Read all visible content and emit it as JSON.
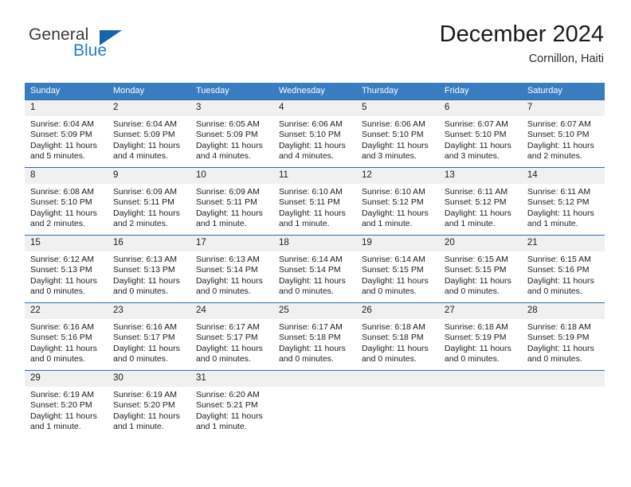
{
  "brand": {
    "name_part1": "General",
    "name_part2": "Blue",
    "triangle_icon": "triangle-icon",
    "accent_color": "#1f7fd0"
  },
  "header": {
    "title": "December 2024",
    "subtitle": "Cornillon, Haiti"
  },
  "theme": {
    "header_row_bg": "#3a7cc0",
    "cell_border": "#2f6fb0",
    "daynum_bg": "#f0f0f0",
    "text": "#1c1c1c"
  },
  "weekday_headers": [
    "Sunday",
    "Monday",
    "Tuesday",
    "Wednesday",
    "Thursday",
    "Friday",
    "Saturday"
  ],
  "weeks": [
    [
      {
        "day": "1",
        "sunrise": "Sunrise: 6:04 AM",
        "sunset": "Sunset: 5:09 PM",
        "daylight_line1": "Daylight: 11 hours",
        "daylight_line2": "and 5 minutes."
      },
      {
        "day": "2",
        "sunrise": "Sunrise: 6:04 AM",
        "sunset": "Sunset: 5:09 PM",
        "daylight_line1": "Daylight: 11 hours",
        "daylight_line2": "and 4 minutes."
      },
      {
        "day": "3",
        "sunrise": "Sunrise: 6:05 AM",
        "sunset": "Sunset: 5:09 PM",
        "daylight_line1": "Daylight: 11 hours",
        "daylight_line2": "and 4 minutes."
      },
      {
        "day": "4",
        "sunrise": "Sunrise: 6:06 AM",
        "sunset": "Sunset: 5:10 PM",
        "daylight_line1": "Daylight: 11 hours",
        "daylight_line2": "and 4 minutes."
      },
      {
        "day": "5",
        "sunrise": "Sunrise: 6:06 AM",
        "sunset": "Sunset: 5:10 PM",
        "daylight_line1": "Daylight: 11 hours",
        "daylight_line2": "and 3 minutes."
      },
      {
        "day": "6",
        "sunrise": "Sunrise: 6:07 AM",
        "sunset": "Sunset: 5:10 PM",
        "daylight_line1": "Daylight: 11 hours",
        "daylight_line2": "and 3 minutes."
      },
      {
        "day": "7",
        "sunrise": "Sunrise: 6:07 AM",
        "sunset": "Sunset: 5:10 PM",
        "daylight_line1": "Daylight: 11 hours",
        "daylight_line2": "and 2 minutes."
      }
    ],
    [
      {
        "day": "8",
        "sunrise": "Sunrise: 6:08 AM",
        "sunset": "Sunset: 5:10 PM",
        "daylight_line1": "Daylight: 11 hours",
        "daylight_line2": "and 2 minutes."
      },
      {
        "day": "9",
        "sunrise": "Sunrise: 6:09 AM",
        "sunset": "Sunset: 5:11 PM",
        "daylight_line1": "Daylight: 11 hours",
        "daylight_line2": "and 2 minutes."
      },
      {
        "day": "10",
        "sunrise": "Sunrise: 6:09 AM",
        "sunset": "Sunset: 5:11 PM",
        "daylight_line1": "Daylight: 11 hours",
        "daylight_line2": "and 1 minute."
      },
      {
        "day": "11",
        "sunrise": "Sunrise: 6:10 AM",
        "sunset": "Sunset: 5:11 PM",
        "daylight_line1": "Daylight: 11 hours",
        "daylight_line2": "and 1 minute."
      },
      {
        "day": "12",
        "sunrise": "Sunrise: 6:10 AM",
        "sunset": "Sunset: 5:12 PM",
        "daylight_line1": "Daylight: 11 hours",
        "daylight_line2": "and 1 minute."
      },
      {
        "day": "13",
        "sunrise": "Sunrise: 6:11 AM",
        "sunset": "Sunset: 5:12 PM",
        "daylight_line1": "Daylight: 11 hours",
        "daylight_line2": "and 1 minute."
      },
      {
        "day": "14",
        "sunrise": "Sunrise: 6:11 AM",
        "sunset": "Sunset: 5:12 PM",
        "daylight_line1": "Daylight: 11 hours",
        "daylight_line2": "and 1 minute."
      }
    ],
    [
      {
        "day": "15",
        "sunrise": "Sunrise: 6:12 AM",
        "sunset": "Sunset: 5:13 PM",
        "daylight_line1": "Daylight: 11 hours",
        "daylight_line2": "and 0 minutes."
      },
      {
        "day": "16",
        "sunrise": "Sunrise: 6:13 AM",
        "sunset": "Sunset: 5:13 PM",
        "daylight_line1": "Daylight: 11 hours",
        "daylight_line2": "and 0 minutes."
      },
      {
        "day": "17",
        "sunrise": "Sunrise: 6:13 AM",
        "sunset": "Sunset: 5:14 PM",
        "daylight_line1": "Daylight: 11 hours",
        "daylight_line2": "and 0 minutes."
      },
      {
        "day": "18",
        "sunrise": "Sunrise: 6:14 AM",
        "sunset": "Sunset: 5:14 PM",
        "daylight_line1": "Daylight: 11 hours",
        "daylight_line2": "and 0 minutes."
      },
      {
        "day": "19",
        "sunrise": "Sunrise: 6:14 AM",
        "sunset": "Sunset: 5:15 PM",
        "daylight_line1": "Daylight: 11 hours",
        "daylight_line2": "and 0 minutes."
      },
      {
        "day": "20",
        "sunrise": "Sunrise: 6:15 AM",
        "sunset": "Sunset: 5:15 PM",
        "daylight_line1": "Daylight: 11 hours",
        "daylight_line2": "and 0 minutes."
      },
      {
        "day": "21",
        "sunrise": "Sunrise: 6:15 AM",
        "sunset": "Sunset: 5:16 PM",
        "daylight_line1": "Daylight: 11 hours",
        "daylight_line2": "and 0 minutes."
      }
    ],
    [
      {
        "day": "22",
        "sunrise": "Sunrise: 6:16 AM",
        "sunset": "Sunset: 5:16 PM",
        "daylight_line1": "Daylight: 11 hours",
        "daylight_line2": "and 0 minutes."
      },
      {
        "day": "23",
        "sunrise": "Sunrise: 6:16 AM",
        "sunset": "Sunset: 5:17 PM",
        "daylight_line1": "Daylight: 11 hours",
        "daylight_line2": "and 0 minutes."
      },
      {
        "day": "24",
        "sunrise": "Sunrise: 6:17 AM",
        "sunset": "Sunset: 5:17 PM",
        "daylight_line1": "Daylight: 11 hours",
        "daylight_line2": "and 0 minutes."
      },
      {
        "day": "25",
        "sunrise": "Sunrise: 6:17 AM",
        "sunset": "Sunset: 5:18 PM",
        "daylight_line1": "Daylight: 11 hours",
        "daylight_line2": "and 0 minutes."
      },
      {
        "day": "26",
        "sunrise": "Sunrise: 6:18 AM",
        "sunset": "Sunset: 5:18 PM",
        "daylight_line1": "Daylight: 11 hours",
        "daylight_line2": "and 0 minutes."
      },
      {
        "day": "27",
        "sunrise": "Sunrise: 6:18 AM",
        "sunset": "Sunset: 5:19 PM",
        "daylight_line1": "Daylight: 11 hours",
        "daylight_line2": "and 0 minutes."
      },
      {
        "day": "28",
        "sunrise": "Sunrise: 6:18 AM",
        "sunset": "Sunset: 5:19 PM",
        "daylight_line1": "Daylight: 11 hours",
        "daylight_line2": "and 0 minutes."
      }
    ],
    [
      {
        "day": "29",
        "sunrise": "Sunrise: 6:19 AM",
        "sunset": "Sunset: 5:20 PM",
        "daylight_line1": "Daylight: 11 hours",
        "daylight_line2": "and 1 minute."
      },
      {
        "day": "30",
        "sunrise": "Sunrise: 6:19 AM",
        "sunset": "Sunset: 5:20 PM",
        "daylight_line1": "Daylight: 11 hours",
        "daylight_line2": "and 1 minute."
      },
      {
        "day": "31",
        "sunrise": "Sunrise: 6:20 AM",
        "sunset": "Sunset: 5:21 PM",
        "daylight_line1": "Daylight: 11 hours",
        "daylight_line2": "and 1 minute."
      },
      {
        "day": "",
        "sunrise": "",
        "sunset": "",
        "daylight_line1": "",
        "daylight_line2": ""
      },
      {
        "day": "",
        "sunrise": "",
        "sunset": "",
        "daylight_line1": "",
        "daylight_line2": ""
      },
      {
        "day": "",
        "sunrise": "",
        "sunset": "",
        "daylight_line1": "",
        "daylight_line2": ""
      },
      {
        "day": "",
        "sunrise": "",
        "sunset": "",
        "daylight_line1": "",
        "daylight_line2": ""
      }
    ]
  ]
}
